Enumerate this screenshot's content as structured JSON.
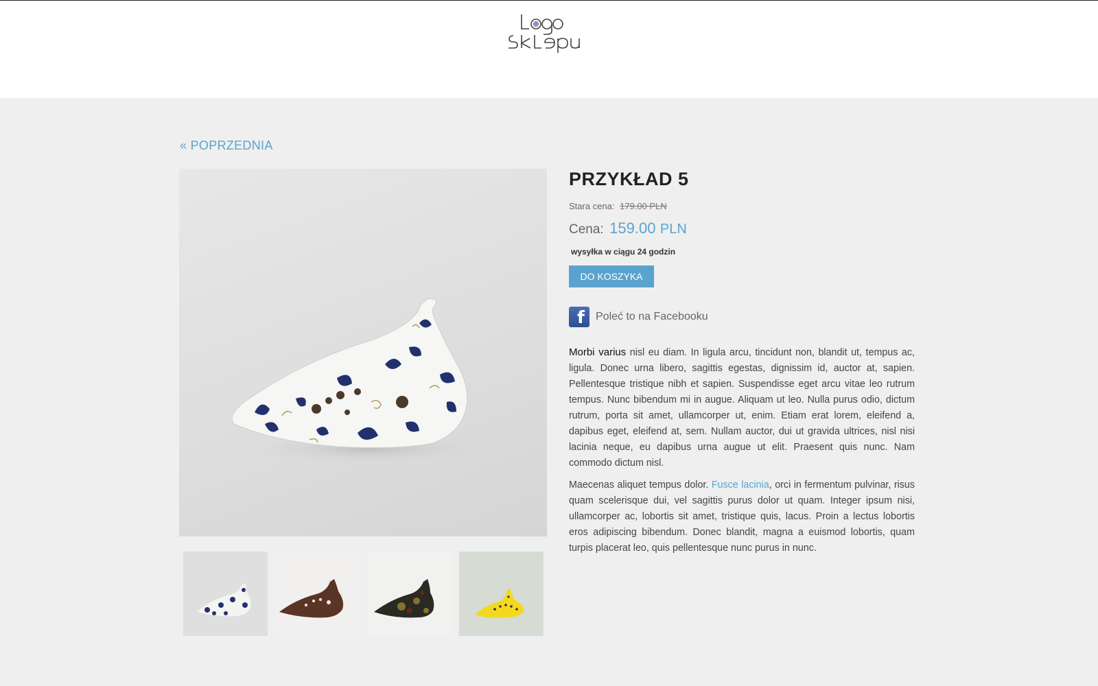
{
  "header": {
    "logo_text": "Logo sklepu"
  },
  "nav": {
    "back_label": "« POPRZEDNIA"
  },
  "product": {
    "title": "PRZYKŁAD 5",
    "old_price_label": "Stara cena:",
    "old_price_value": "179.00 PLN",
    "price_label": "Cena:",
    "price_value": "159.00",
    "currency": "PLN",
    "shipping": "wysyłka w ciągu 24 godzin",
    "cart_button": "DO KOSZYKA",
    "facebook_label": "Poleć to na Facebooku"
  },
  "description": {
    "p1_strong": "Morbi varius",
    "p1_rest": " nisl eu diam. In ligula arcu, tincidunt non, blandit ut, tempus ac, ligula. Donec urna libero, sagittis egestas, dignissim id, auctor at, sapien. Pellentesque tristique nibh et sapien. Suspendisse eget arcu vitae leo rutrum tempus. Nunc bibendum mi in augue. Aliquam ut leo. Nulla purus odio, dictum rutrum, porta sit amet, ullamcorper ut, enim. Etiam erat lorem, eleifend a, dapibus eget, eleifend at, sem. Nullam auctor, dui ut gravida ultrices, nisl nisi lacinia neque, eu dapibus urna augue ut elit. Praesent quis nunc. Nam commodo dictum nisl.",
    "p2_start": "Maecenas aliquet tempus dolor. ",
    "p2_link": "Fusce lacinia",
    "p2_rest": ", orci in fermentum pulvinar, risus quam scelerisque dui, vel sagittis purus dolor ut quam. Integer ipsum nisi, ullamcorper ac, lobortis sit amet, tristique quis, lacus. Proin a lectus lobortis eros adipiscing bibendum. Donec blandit, magna a euismod lobortis, quam turpis placerat leo, quis pellentesque nunc purus in nunc."
  },
  "gallery": {
    "main_image": "white-blue-floral-ocarina-photo",
    "thumbnails": [
      "white-blue-floral-ocarina-thumb",
      "brown-ocarina-thumb",
      "dark-multicolor-ocarina-thumb",
      "yellow-ocarina-thumb"
    ]
  },
  "colors": {
    "accent": "#5ba3cf",
    "page_bg": "#efefef",
    "header_bg": "#ffffff",
    "facebook_blue": "#3b5998"
  }
}
